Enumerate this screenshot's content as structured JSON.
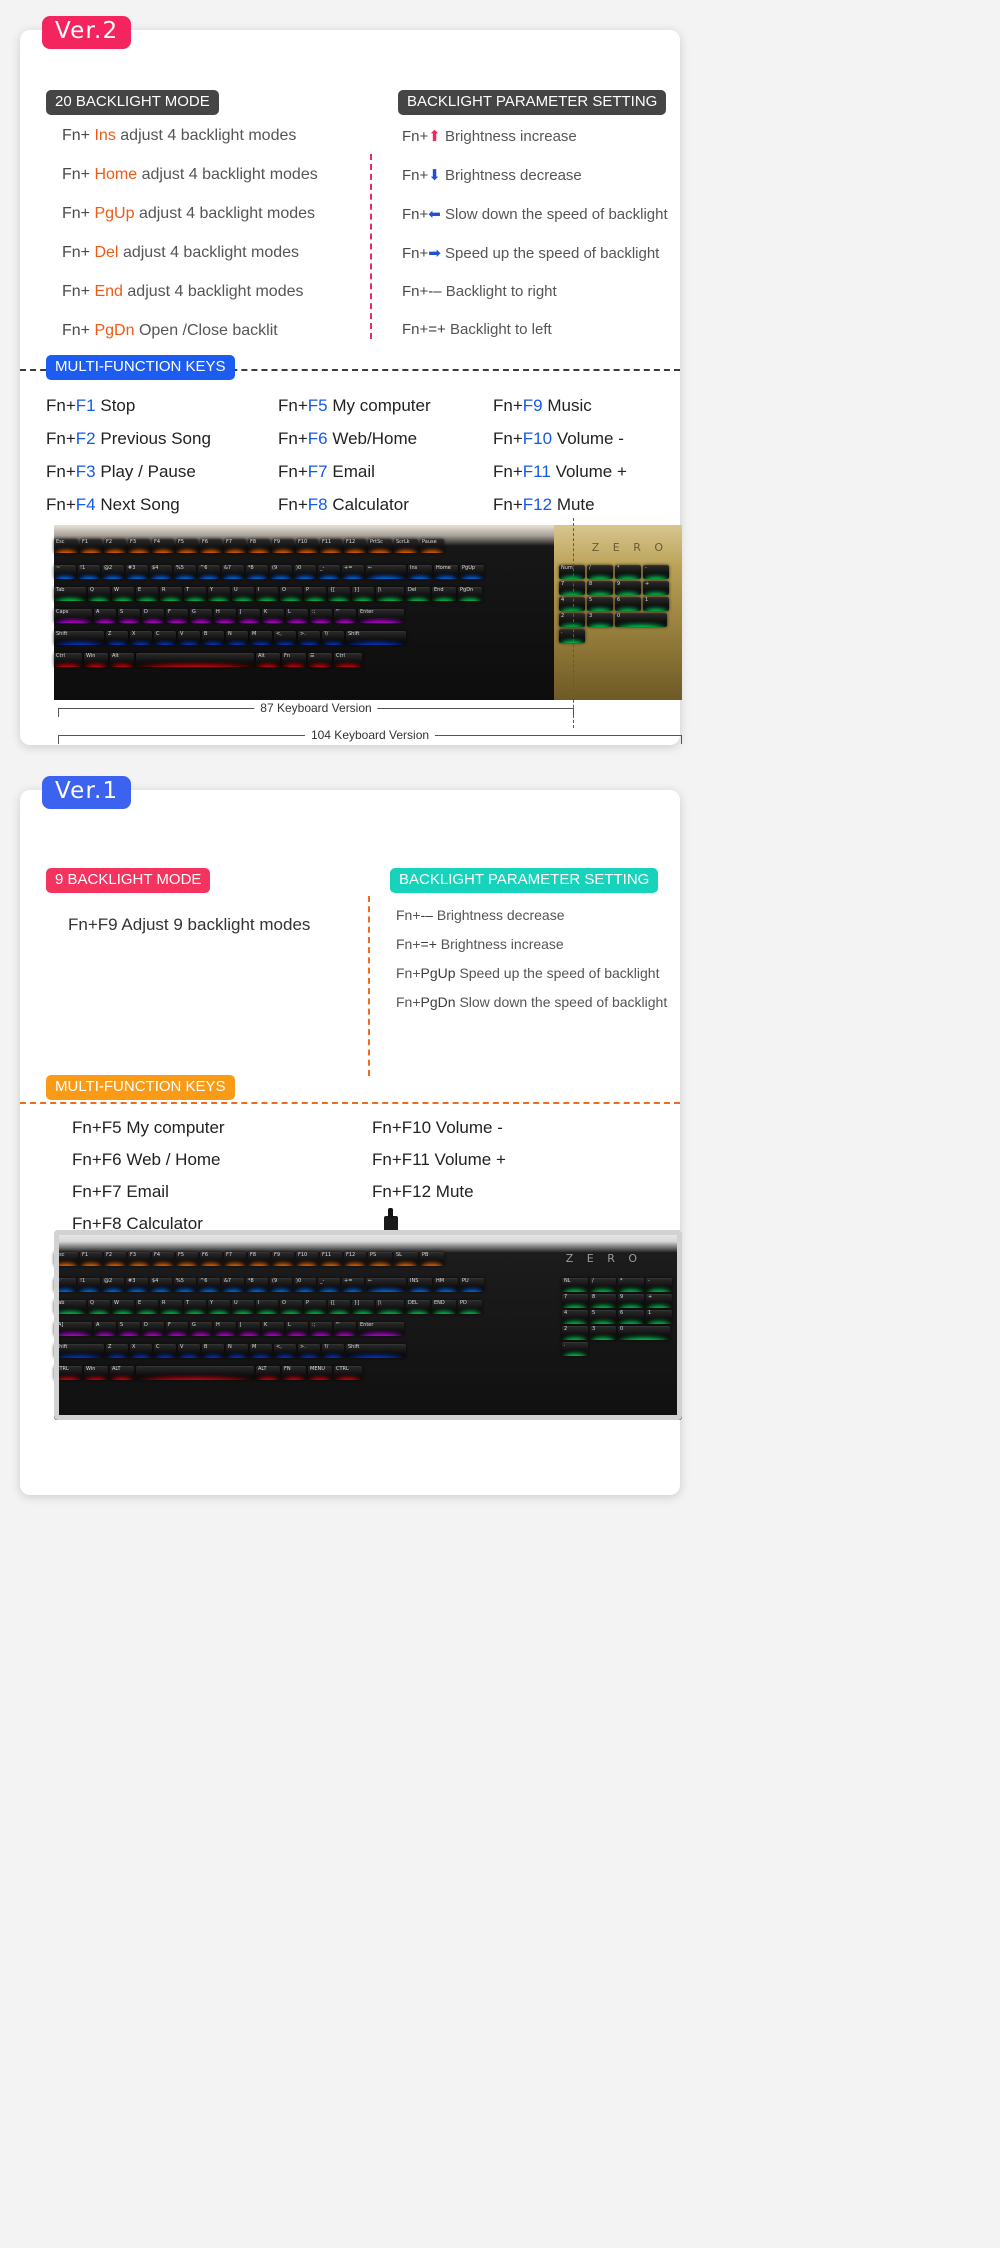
{
  "colors": {
    "ver2_badge": "#f4245e",
    "ver1_badge": "#3b63f0",
    "chip_dark": "#454545",
    "chip_blue": "#1d5cf0",
    "chip_pink": "#f4335e",
    "chip_teal": "#17d3bb",
    "chip_orange": "#f99b16",
    "key_orange": "#ef5a16",
    "key_blue": "#1559e8",
    "divider_pink": "#e8296b",
    "divider_orange": "#ef6b1f",
    "divider_dark": "#3b3b3b",
    "red_guide_line": "#e02020"
  },
  "ver2": {
    "badge": "Ver.2",
    "backlight_mode": {
      "title": "20 BACKLIGHT MODE",
      "rows": [
        {
          "fn": "Fn+",
          "key": "Ins",
          "desc": "adjust 4 backlight modes"
        },
        {
          "fn": "Fn+",
          "key": "Home",
          "desc": "adjust 4 backlight modes"
        },
        {
          "fn": "Fn+",
          "key": "PgUp",
          "desc": "adjust 4 backlight modes"
        },
        {
          "fn": "Fn+",
          "key": "Del",
          "desc": "adjust 4 backlight modes"
        },
        {
          "fn": "Fn+",
          "key": "End",
          "desc": "adjust 4 backlight modes"
        },
        {
          "fn": "Fn+",
          "key": "PgDn",
          "desc": "Open /Close backlit"
        }
      ]
    },
    "parameter_setting": {
      "title": "BACKLIGHT PARAMETER SETTING",
      "rows": [
        {
          "fn": "Fn+",
          "key": "⬆",
          "icon": "arrow-up-icon",
          "desc": "Brightness increase"
        },
        {
          "fn": "Fn+",
          "key": "⬇",
          "icon": "arrow-down-icon",
          "desc": "Brightness decrease"
        },
        {
          "fn": "Fn+",
          "key": "⬅",
          "icon": "arrow-left-icon",
          "desc": "Slow down the speed of backlight"
        },
        {
          "fn": "Fn+",
          "key": "➡",
          "icon": "arrow-right-icon",
          "desc": "Speed up the speed of backlight"
        },
        {
          "fn": "Fn+",
          "key": "-–",
          "icon": "minus-key-icon",
          "desc": "Backlight to right"
        },
        {
          "fn": "Fn+",
          "key": "=+",
          "icon": "plus-key-icon",
          "desc": "Backlight to left"
        }
      ]
    },
    "multi_function": {
      "title": "MULTI-FUNCTION KEYS",
      "columns": [
        [
          {
            "fn": "Fn+",
            "key": "F1",
            "desc": "Stop"
          },
          {
            "fn": "Fn+",
            "key": "F2",
            "desc": "Previous Song"
          },
          {
            "fn": "Fn+",
            "key": "F3",
            "desc": "Play / Pause"
          },
          {
            "fn": "Fn+",
            "key": "F4",
            "desc": "Next Song"
          }
        ],
        [
          {
            "fn": "Fn+",
            "key": "F5",
            "desc": "My computer"
          },
          {
            "fn": "Fn+",
            "key": "F6",
            "desc": "Web/Home"
          },
          {
            "fn": "Fn+",
            "key": "F7",
            "desc": "Email"
          },
          {
            "fn": "Fn+",
            "key": "F8",
            "desc": "Calculator"
          }
        ],
        [
          {
            "fn": "Fn+",
            "key": "F9",
            "desc": "Music"
          },
          {
            "fn": "Fn+",
            "key": "F10",
            "desc": "Volume -"
          },
          {
            "fn": "Fn+",
            "key": "F11",
            "desc": "Volume +"
          },
          {
            "fn": "Fn+",
            "key": "F12",
            "desc": "Mute"
          }
        ]
      ]
    },
    "keyboard": {
      "brand": "Z E R O",
      "bracket_87": "87 Keyboard Version",
      "bracket_104": "104 Keyboard Version",
      "row_fn": [
        "Esc",
        "F1",
        "F2",
        "F3",
        "F4",
        "F5",
        "F6",
        "F7",
        "F8",
        "F9",
        "F10",
        "F11",
        "F12",
        "PrtSc",
        "ScrLk",
        "Pause"
      ],
      "row_num": [
        "~`",
        "!1",
        "@2",
        "#3",
        "$4",
        "%5",
        "^6",
        "&7",
        "*8",
        "(9",
        ")0",
        "_-",
        "+=",
        "←",
        "Ins",
        "Home",
        "PgUp"
      ],
      "row_tab": [
        "Tab",
        "Q",
        "W",
        "E",
        "R",
        "T",
        "Y",
        "U",
        "I",
        "O",
        "P",
        "{[",
        "}]",
        "|\\",
        "Del",
        "End",
        "PgDn"
      ],
      "row_caps": [
        "Caps",
        "A",
        "S",
        "D",
        "F",
        "G",
        "H",
        "J",
        "K",
        "L",
        ":;",
        "\"'",
        "Enter"
      ],
      "row_shift": [
        "Shift",
        "Z",
        "X",
        "C",
        "V",
        "B",
        "N",
        "M",
        "<,",
        ">.",
        "?/",
        "Shift"
      ],
      "row_ctrl": [
        "Ctrl",
        "Win",
        "Alt",
        "",
        "Alt",
        "Fn",
        "☰",
        "Ctrl"
      ],
      "numpad": [
        "Num",
        "/",
        "*",
        "-",
        "7",
        "8",
        "9",
        "+",
        "4",
        "5",
        "6",
        "1",
        "2",
        "3",
        "0",
        "."
      ]
    }
  },
  "ver1": {
    "badge": "Ver.1",
    "backlight_mode": {
      "title": "9 BACKLIGHT MODE",
      "rows": [
        {
          "fn": "Fn+F9",
          "key": "",
          "desc": "Adjust 9 backlight modes"
        }
      ]
    },
    "parameter_setting": {
      "title": "BACKLIGHT PARAMETER SETTING",
      "rows": [
        {
          "fn": "Fn+",
          "key": "-–",
          "icon": "minus-key-icon",
          "desc": "Brightness decrease"
        },
        {
          "fn": "Fn+",
          "key": "=+",
          "icon": "plus-key-icon",
          "desc": "Brightness increase"
        },
        {
          "fn": "Fn+",
          "key": "PgUp",
          "icon": "pgup-key-icon",
          "desc": "Speed up the speed of backlight"
        },
        {
          "fn": "Fn+",
          "key": "PgDn",
          "icon": "pgdn-key-icon",
          "desc": "Slow down the speed of backlight"
        }
      ]
    },
    "multi_function": {
      "title": "MULTI-FUNCTION KEYS",
      "columns": [
        [
          {
            "fn": "Fn+F5",
            "desc": "My computer"
          },
          {
            "fn": "Fn+F6",
            "desc": "Web / Home"
          },
          {
            "fn": "Fn+F7",
            "desc": "Email"
          },
          {
            "fn": "Fn+F8",
            "desc": "Calculator"
          }
        ],
        [
          {
            "fn": "Fn+F10",
            "desc": "Volume -"
          },
          {
            "fn": "Fn+F11",
            "desc": "Volume +"
          },
          {
            "fn": "Fn+F12",
            "desc": "Mute"
          }
        ]
      ]
    },
    "keyboard": {
      "brand": "Z E R O",
      "row_fn": [
        "Esc",
        "F1",
        "F2",
        "F3",
        "F4",
        "F5",
        "F6",
        "F7",
        "F8",
        "F9",
        "F10",
        "F11",
        "F12",
        "PS",
        "SL",
        "PB"
      ],
      "row_num": [
        "~`",
        "!1",
        "@2",
        "#3",
        "$4",
        "%5",
        "^6",
        "&7",
        "*8",
        "(9",
        ")0",
        "_-",
        "+=",
        "←",
        "INS",
        "HM",
        "PU"
      ],
      "row_tab": [
        "Tab",
        "Q",
        "W",
        "E",
        "R",
        "T",
        "Y",
        "U",
        "I",
        "O",
        "P",
        "{[",
        "}]",
        "|\\",
        "DEL",
        "END",
        "PD"
      ],
      "row_caps": [
        "[A]",
        "A",
        "S",
        "D",
        "F",
        "G",
        "H",
        "J",
        "K",
        "L",
        ":;",
        "\"'",
        "Enter"
      ],
      "row_shift": [
        "Shift",
        "Z",
        "X",
        "C",
        "V",
        "B",
        "N",
        "M",
        "<,",
        ">.",
        "?/",
        "Shift"
      ],
      "row_ctrl": [
        "CTRL",
        "Win",
        "ALT",
        "",
        "ALT",
        "FN",
        "MENU",
        "CTRL"
      ],
      "numpad": [
        "NL",
        "/",
        "*",
        "-",
        "7",
        "8",
        "9",
        "+",
        "4",
        "5",
        "6",
        "1",
        "2",
        "3",
        "0",
        "."
      ]
    }
  }
}
